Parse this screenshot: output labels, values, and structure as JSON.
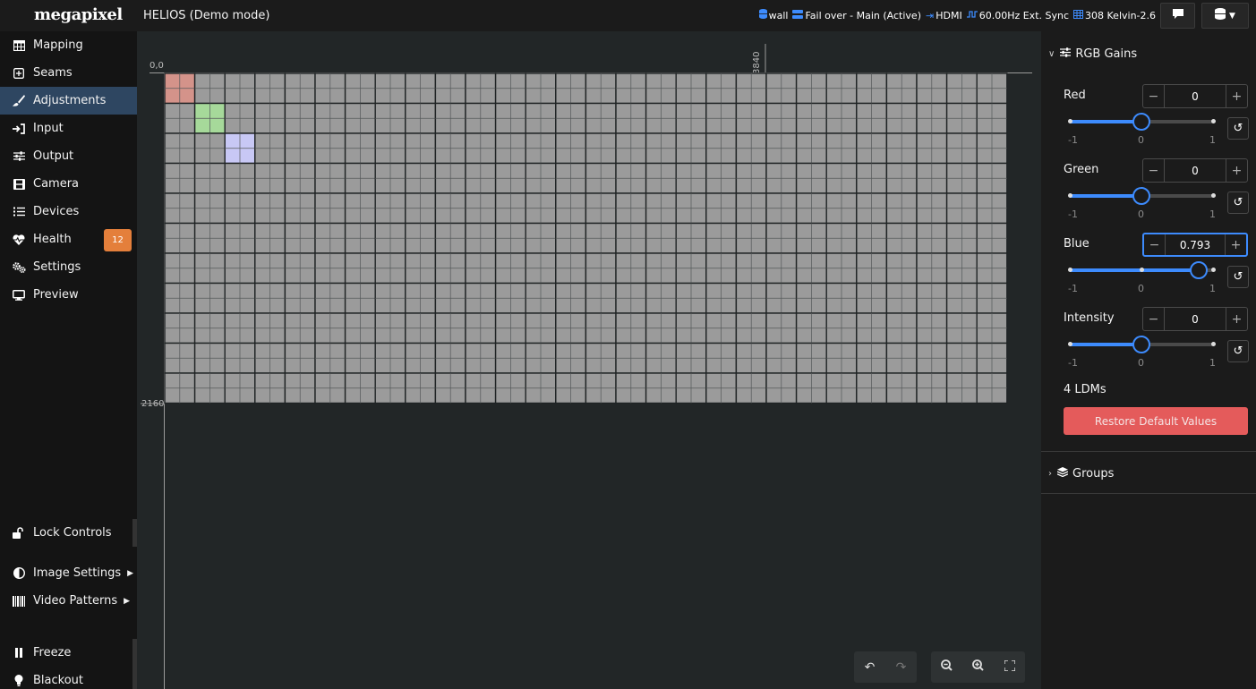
{
  "app": {
    "logo": "megapixel",
    "title": "HELIOS (Demo mode)"
  },
  "status": {
    "wall": "wall",
    "failover": "Fail over - Main (Active)",
    "input": "HDMI",
    "sync": "60.00Hz Ext. Sync",
    "grid_info": "308 Kelvin-2.6"
  },
  "sidebar": {
    "items": [
      {
        "label": "Mapping",
        "icon": "table-icon"
      },
      {
        "label": "Seams",
        "icon": "plus-square-icon"
      },
      {
        "label": "Adjustments",
        "icon": "paintbrush-icon"
      },
      {
        "label": "Input",
        "icon": "sign-in-icon"
      },
      {
        "label": "Output",
        "icon": "sliders-icon"
      },
      {
        "label": "Camera",
        "icon": "film-icon"
      },
      {
        "label": "Devices",
        "icon": "list-icon"
      },
      {
        "label": "Health",
        "icon": "heartbeat-icon",
        "badge": "12"
      },
      {
        "label": "Settings",
        "icon": "gears-icon"
      },
      {
        "label": "Preview",
        "icon": "monitor-icon"
      }
    ],
    "active_index": 2,
    "lock_controls": "Lock Controls",
    "image_settings": "Image Settings",
    "video_patterns": "Video Patterns",
    "freeze": "Freeze",
    "blackout": "Blackout"
  },
  "canvas": {
    "origin_label": "0,0",
    "width_label": "3840",
    "height_label": "2160",
    "grid": {
      "cols": 28,
      "rows": 11
    },
    "highlighted_tiles": [
      {
        "col": 0,
        "row": 0,
        "color": "#d4938a"
      },
      {
        "col": 1,
        "row": 1,
        "color": "#a6d99a"
      },
      {
        "col": 2,
        "row": 2,
        "color": "#c8c8f5"
      }
    ],
    "tile_color": "#9b9b9b"
  },
  "rgb_gains": {
    "title": "RGB Gains",
    "min_label": "-1",
    "mid_label": "0",
    "max_label": "1",
    "channels": [
      {
        "label": "Red",
        "value": "0",
        "fraction": 0.5
      },
      {
        "label": "Green",
        "value": "0",
        "fraction": 0.5
      },
      {
        "label": "Blue",
        "value": "0.793",
        "fraction": 0.8965,
        "focused": true
      },
      {
        "label": "Intensity",
        "value": "0",
        "fraction": 0.5
      }
    ],
    "ldm_count": "4 LDMs",
    "restore_label": "Restore Default Values"
  },
  "groups": {
    "title": "Groups"
  },
  "colors": {
    "accent": "#3d8bfd",
    "restore": "#e45b5b",
    "badge": "#e47f3b",
    "active_nav": "#2e4661"
  }
}
